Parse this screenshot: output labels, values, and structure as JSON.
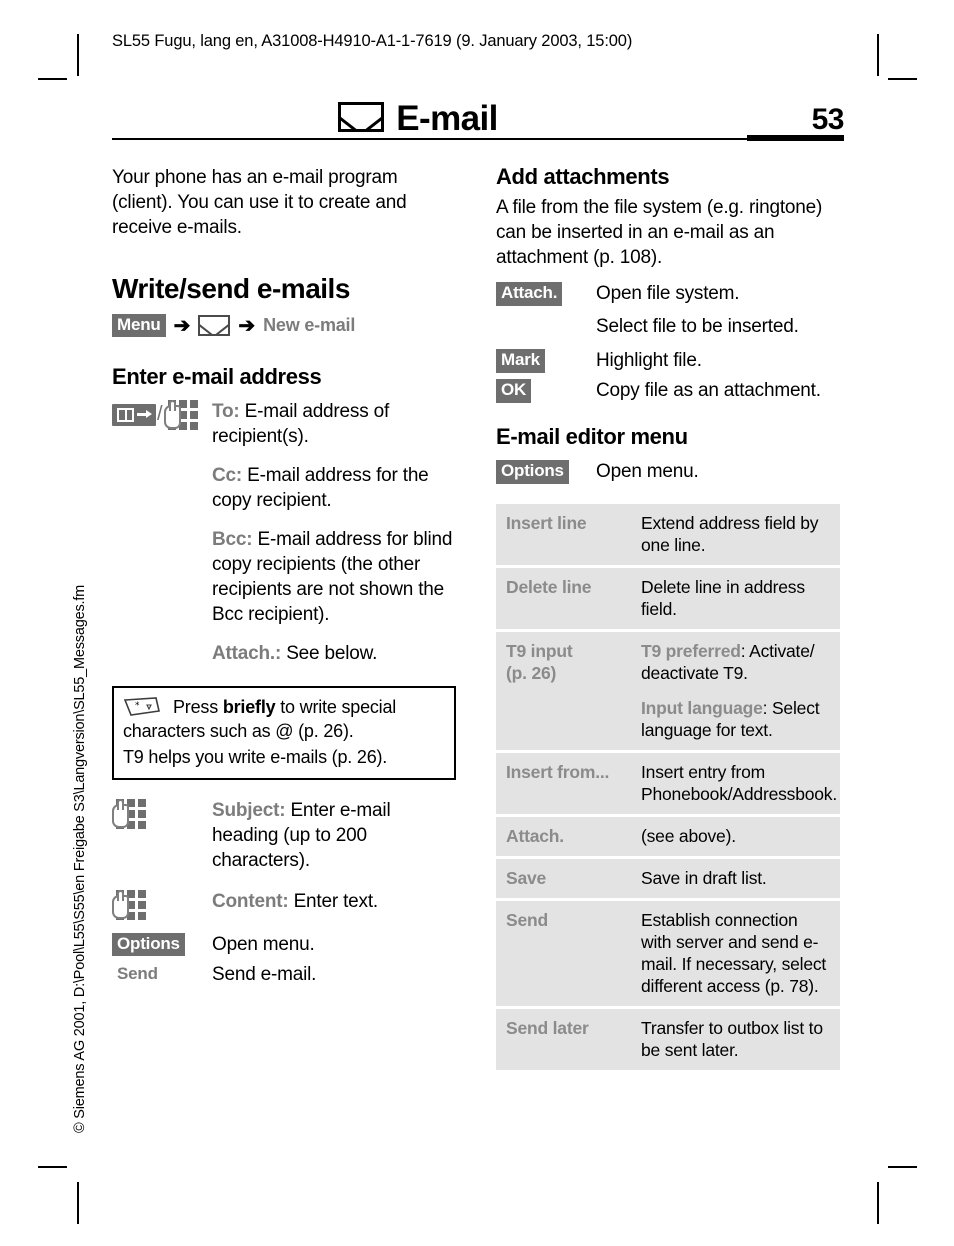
{
  "document": {
    "running_header": "SL55 Fugu, lang en, A31008-H4910-A1-1-7619 (9. January 2003, 15:00)",
    "side_note": "© Siemens AG 2001, D:\\Pool\\L55\\S55\\en Freigabe S3\\Langversion\\SL55_Messages.fm",
    "chapter_title": "E-mail",
    "page_number": "53",
    "title_icon": "envelope-icon"
  },
  "colors": {
    "softkey_badge_bg": "#6e6e6e",
    "softkey_badge_text": "#ffffff",
    "label_gray": "#7c7c7c",
    "table_row_bg": "#e3e3e3",
    "table_key_gray": "#8b8b8b",
    "rule": "#000000"
  },
  "left_column": {
    "intro": "Your phone has an e-mail program (client). You can use it to create and receive e-mails.",
    "section_title": "Write/send e-mails",
    "nav_path": {
      "menu_label": "Menu",
      "arrow": "➔",
      "envelope_icon": "envelope-icon",
      "destination": "New e-mail"
    },
    "subsection_title": "Enter e-mail address",
    "address_icons": {
      "phonebook_icon": "phonebook-arrow-icon",
      "separator": "/",
      "keypad_icon": "keypad-hand-icon"
    },
    "address_fields": [
      {
        "label": "To:",
        "text": " E-mail address of recipient(s)."
      },
      {
        "label": "Cc:",
        "text": " E-mail address for the copy recipient."
      },
      {
        "label": "Bcc:",
        "text": " E-mail address for blind copy recipients (the other recipients are not shown the Bcc recipient)."
      },
      {
        "label": "Attach.:",
        "text": " See below."
      }
    ],
    "note": {
      "icon": "star-key-icon",
      "line1_pre": "Press ",
      "line1_bold": "briefly",
      "line1_post": " to write special characters such as @ (p. 26).",
      "line2": "T9 helps you write e-mails (p. 26)."
    },
    "compose_rows": [
      {
        "icon": "keypad-hand-icon",
        "label": "Subject:",
        "text": " Enter e-mail heading (up to 200 characters)."
      },
      {
        "icon": "keypad-hand-icon",
        "label": "Content:",
        "text": " Enter text."
      }
    ],
    "softkeys": [
      {
        "key": "Options",
        "badge": true,
        "action": "Open menu."
      },
      {
        "key": "Send",
        "badge": false,
        "action": "Send e-mail."
      }
    ]
  },
  "right_column": {
    "attach_title": "Add attachments",
    "attach_intro": "A file from the file system (e.g. ringtone) can be inserted in an e-mail as an attachment (p. 108).",
    "attach_steps": [
      {
        "key": "Attach.",
        "badge": true,
        "action": "Open file system."
      },
      {
        "key": "",
        "badge": false,
        "action": "Select file to be inserted."
      },
      {
        "key": "Mark",
        "badge": true,
        "action": "Highlight file."
      },
      {
        "key": "OK",
        "badge": true,
        "action": "Copy file as an attachment."
      }
    ],
    "editor_menu_title": "E-mail editor menu",
    "editor_menu_open": {
      "key": "Options",
      "badge": true,
      "action": "Open menu."
    },
    "table": {
      "rows": [
        {
          "key": "Insert line",
          "key_sub": "",
          "values": [
            {
              "em": "",
              "text": "Extend address field by one line."
            }
          ]
        },
        {
          "key": "Delete line",
          "key_sub": "",
          "values": [
            {
              "em": "",
              "text": "Delete line in address field."
            }
          ]
        },
        {
          "key": "T9 input",
          "key_sub": "(p. 26)",
          "values": [
            {
              "em": "T9 preferred",
              "text": ": Activate/ deactivate T9."
            },
            {
              "em": "Input language",
              "text": ": Select language for text."
            }
          ]
        },
        {
          "key": "Insert from...",
          "key_sub": "",
          "values": [
            {
              "em": "",
              "text": "Insert entry from Phonebook/Addressbook."
            }
          ]
        },
        {
          "key": "Attach.",
          "key_sub": "",
          "values": [
            {
              "em": "",
              "text": "(see above)."
            }
          ]
        },
        {
          "key": "Save",
          "key_sub": "",
          "values": [
            {
              "em": "",
              "text": "Save in draft list."
            }
          ]
        },
        {
          "key": "Send",
          "key_sub": "",
          "values": [
            {
              "em": "",
              "text": "Establish connection with server and send e-mail. If necessary, select different access (p. 78)."
            }
          ]
        },
        {
          "key": "Send later",
          "key_sub": "",
          "values": [
            {
              "em": "",
              "text": "Transfer to outbox list to be sent later."
            }
          ]
        }
      ]
    }
  }
}
